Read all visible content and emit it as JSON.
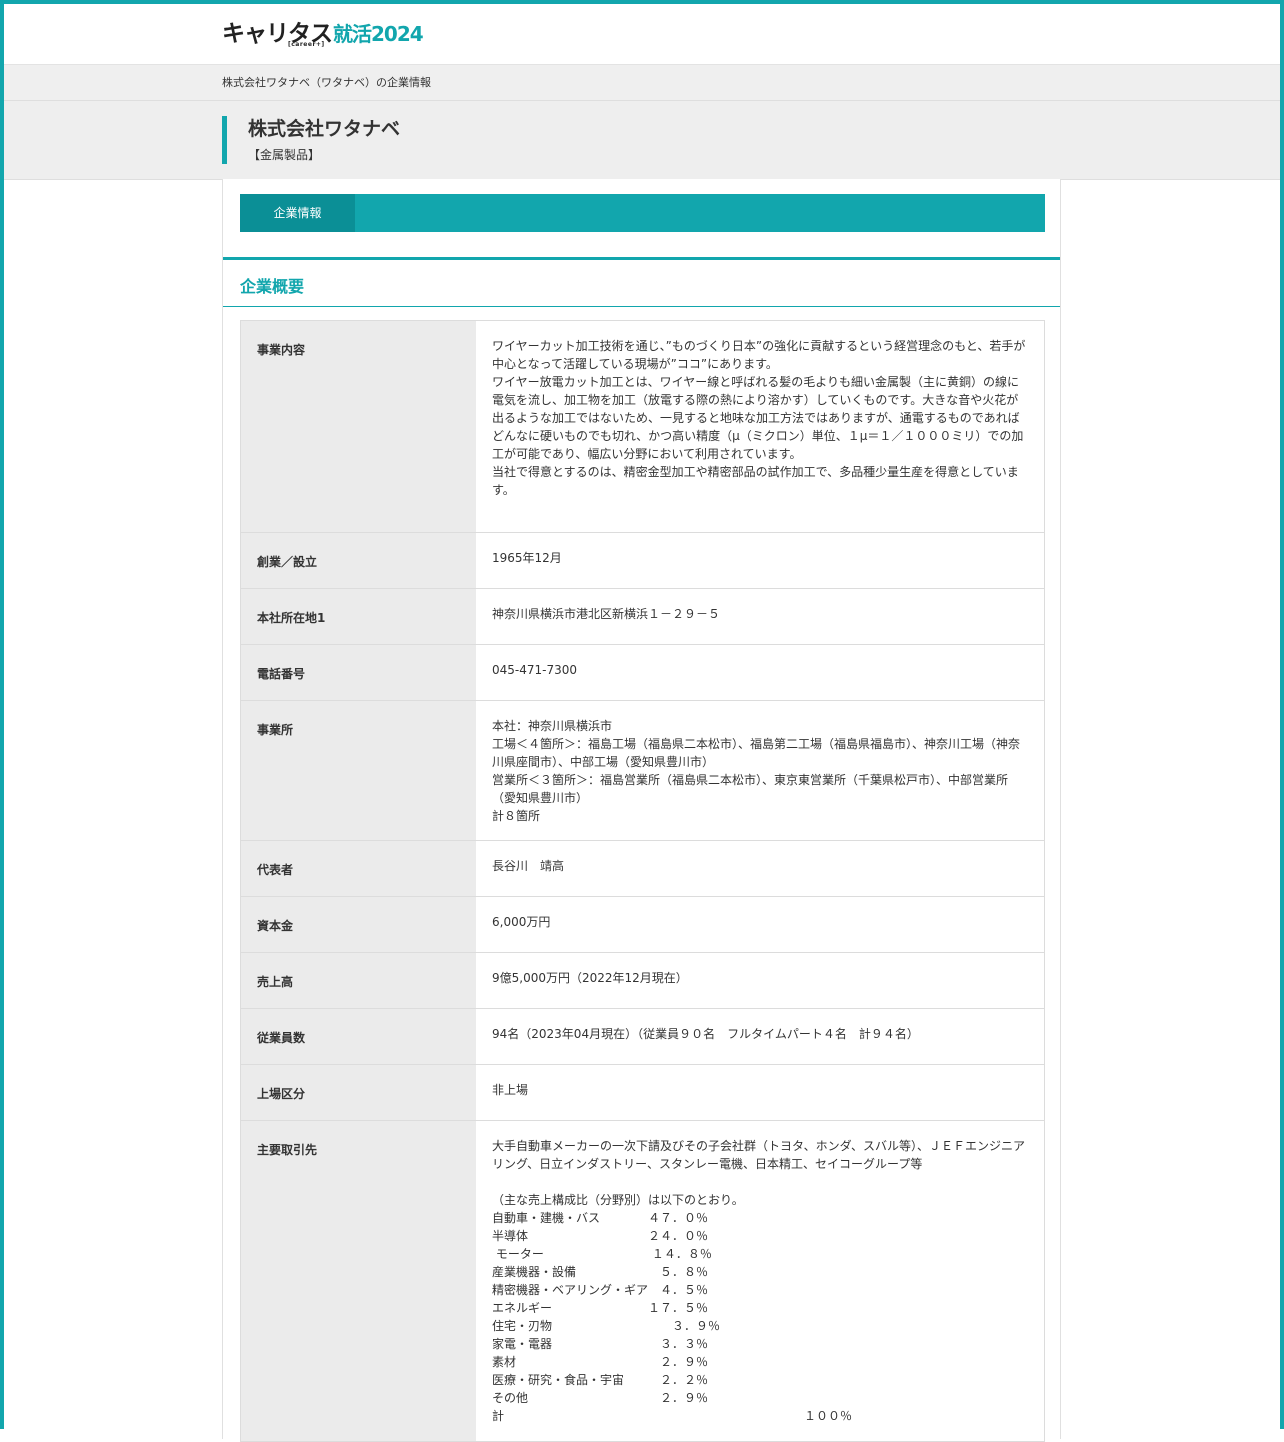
{
  "brand": {
    "logo_main": "キャリタス",
    "logo_accent": "就活2024",
    "logo_sub": "[career+]"
  },
  "breadcrumb": "株式会社ワタナベ（ワタナベ）の企業情報",
  "company": {
    "name": "株式会社ワタナベ",
    "industry": "【金属製品】"
  },
  "tabs": [
    {
      "label": "企業情報",
      "active": true
    }
  ],
  "section": {
    "title": "企業概要"
  },
  "rows": [
    {
      "label": "事業内容",
      "value": "ワイヤーカット加工技術を通じ、”ものづくり日本”の強化に貢献するという経営理念のもと、若手が中心となって活躍している現場が”ココ”にあります。\nワイヤー放電カット加工とは、ワイヤー線と呼ばれる髪の毛よりも細い金属製（主に黄銅）の線に電気を流し、加工物を加工（放電する際の熱により溶かす）していくものです。大きな音や火花が出るような加工ではないため、一見すると地味な加工方法ではありますが、通電するものであればどんなに硬いものでも切れ、かつ高い精度（μ（ミクロン）単位、１μ＝１／１０００ミリ）での加工が可能であり、幅広い分野において利用されています。\n当社で得意とするのは、精密金型加工や精密部品の試作加工で、多品種少量生産を得意としています。"
    },
    {
      "label": "創業／設立",
      "value": "1965年12月"
    },
    {
      "label": "本社所在地1",
      "value": "神奈川県横浜市港北区新横浜１－２９－５"
    },
    {
      "label": "電話番号",
      "value": "045-471-7300"
    },
    {
      "label": "事業所",
      "value": "本社：神奈川県横浜市\n工場＜４箇所＞：福島工場（福島県二本松市）、福島第二工場（福島県福島市）、神奈川工場（神奈川県座間市）、中部工場（愛知県豊川市）\n営業所＜３箇所＞：福島営業所（福島県二本松市）、東京東営業所（千葉県松戸市）、中部営業所（愛知県豊川市）\n計８箇所"
    },
    {
      "label": "代表者",
      "value": "長谷川　靖高"
    },
    {
      "label": "資本金",
      "value": "6,000万円"
    },
    {
      "label": "売上高",
      "value": "9億5,000万円（2022年12月現在）"
    },
    {
      "label": "従業員数",
      "value": "94名（2023年04月現在）（従業員９０名　フルタイムパート４名　計９４名）"
    },
    {
      "label": "上場区分",
      "value": "非上場"
    },
    {
      "label": "主要取引先",
      "value": "大手自動車メーカーの一次下請及びその子会社群（トヨタ、ホンダ、スバル等）、ＪＥＦエンジニアリング、日立インダストリー、スタンレー電機、日本精工、セイコーグループ等\n\n（主な売上構成比（分野別）は以下のとおり。\n自動車・建機・バス　　　　４７．０％\n半導体　　　　　　　　　　２４．０％\n モーター　　　　　　　　　１４．８％\n産業機器・設備　　　　　　　５．８％\n精密機器・ベアリング・ギア　４．５％\nエネルギー　　　　　　　　１７．５％\n住宅・刃物　　　　　　　　　　３．９％\n家電・電器　　　　　　　　　３．３％\n素材　　　　　　　　　　　　２．９％\n医療・研究・食品・宇宙　　　２．２％\nその他　　　　　　　　　　　２．９％\n計　　　　　　　　　　　　　　　　　　　　　　　　　１００％"
    }
  ]
}
